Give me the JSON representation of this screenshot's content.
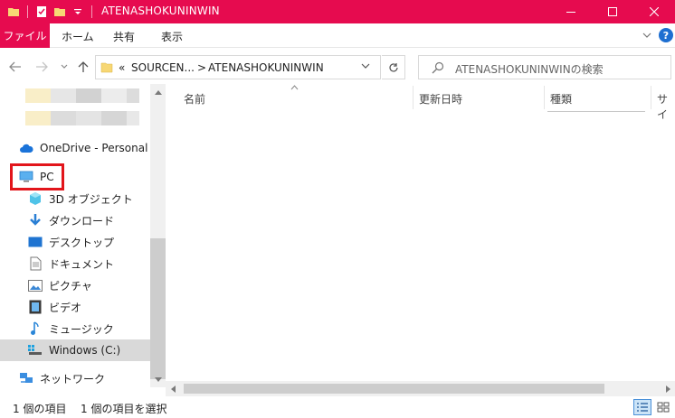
{
  "window": {
    "title": "ATENASHOKUNINWIN",
    "accent_color": "#e60b4f",
    "controls": [
      "minimize",
      "maximize",
      "close"
    ]
  },
  "ribbon": {
    "tabs": [
      {
        "label": "ファイル"
      },
      {
        "label": "ホーム"
      },
      {
        "label": "共有"
      },
      {
        "label": "表示"
      }
    ],
    "help_label": "?"
  },
  "address": {
    "prefix": "«",
    "segments": [
      "SOURCEN...",
      "ATENASHOKUNINWIN"
    ],
    "separator": ">"
  },
  "search": {
    "placeholder": "ATENASHOKUNINWINの検索"
  },
  "nav_pane": {
    "onedrive": "OneDrive - Personal",
    "pc": "PC",
    "items": [
      {
        "label": "3D オブジェクト",
        "icon": "3d-objects-icon"
      },
      {
        "label": "ダウンロード",
        "icon": "download-icon"
      },
      {
        "label": "デスクトップ",
        "icon": "desktop-icon"
      },
      {
        "label": "ドキュメント",
        "icon": "documents-icon"
      },
      {
        "label": "ピクチャ",
        "icon": "pictures-icon"
      },
      {
        "label": "ビデオ",
        "icon": "videos-icon"
      },
      {
        "label": "ミュージック",
        "icon": "music-icon"
      },
      {
        "label": "Windows (C:)",
        "icon": "drive-icon",
        "selected": true
      }
    ],
    "network": "ネットワーク"
  },
  "columns": [
    "名前",
    "更新日時",
    "種類",
    "サイ"
  ],
  "status": {
    "item_count": "1 個の項目",
    "selected": "1 個の項目を選択"
  }
}
